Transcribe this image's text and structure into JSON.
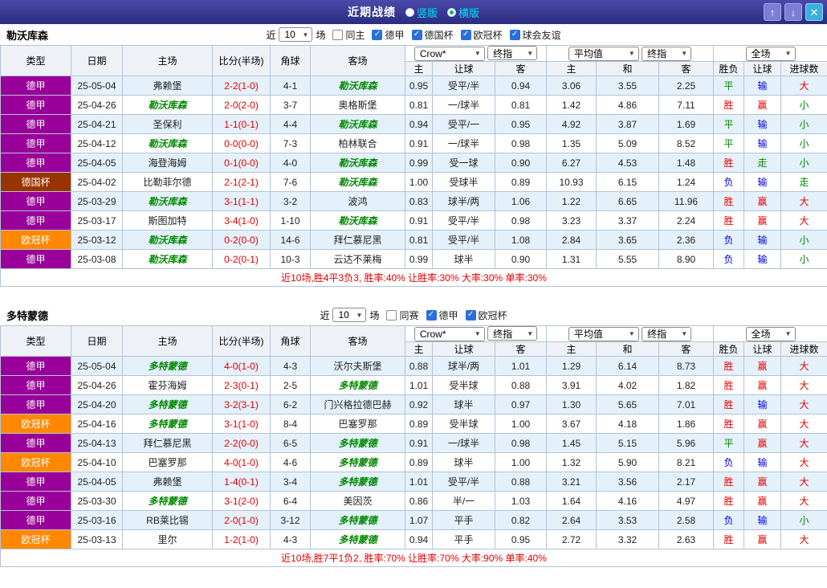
{
  "colors": {
    "topbar": "#2c2c80",
    "row_alt": "#e4f1fb",
    "focus_team": "#008800",
    "score": "#e60000",
    "summary_text": "#e60000",
    "league": {
      "德甲": "#990099",
      "德国杯": "#993300",
      "欧冠杯": "#ff8800"
    },
    "wdl": {
      "胜": "#e60000",
      "平": "#008800",
      "负": "#0000e6"
    },
    "handicap_result": {
      "赢": "#e60000",
      "走": "#008800",
      "输": "#0000e6"
    },
    "goals_result": {
      "大": "#e60000",
      "走": "#008800",
      "小": "#008800"
    }
  },
  "topbar": {
    "title": "近期战绩",
    "radios": [
      {
        "label": "竖版",
        "selected": false
      },
      {
        "label": "横版",
        "selected": true
      }
    ],
    "buttons": {
      "up": "↑",
      "down": "↓",
      "close": "✕"
    }
  },
  "table_header": {
    "type": "类型",
    "date": "日期",
    "home": "主场",
    "score": "比分(半场)",
    "corner": "角球",
    "away": "客场",
    "group1_selects": [
      "Crow*",
      "终指"
    ],
    "group1_cols": [
      "主",
      "让球",
      "客"
    ],
    "group2_selects": [
      "平均值",
      "终指"
    ],
    "group2_cols": [
      "主",
      "和",
      "客"
    ],
    "group3_selects": [
      "全场"
    ],
    "group3_cols": [
      "胜负",
      "让球",
      "进球数"
    ]
  },
  "sections": [
    {
      "team": "勒沃库森",
      "filter": {
        "prefix": "近",
        "count": "10",
        "suffix": "场",
        "unchecked": [
          "同主"
        ],
        "checked": [
          "德甲",
          "德国杯",
          "欧冠杯",
          "球会友谊"
        ]
      },
      "rows": [
        {
          "league": "德甲",
          "date": "25-05-04",
          "home": "弗赖堡",
          "home_focus": false,
          "score": "2-2(1-0)",
          "corner": "4-1",
          "away": "勒沃库森",
          "away_focus": true,
          "o_home": "0.95",
          "handicap": "受平/半",
          "o_away": "0.94",
          "avg_win": "3.06",
          "avg_draw": "3.55",
          "avg_lose": "2.25",
          "wdl": "平",
          "hr": "输",
          "gr": "大"
        },
        {
          "league": "德甲",
          "date": "25-04-26",
          "home": "勒沃库森",
          "home_focus": true,
          "score": "2-0(2-0)",
          "corner": "3-7",
          "away": "奥格斯堡",
          "away_focus": false,
          "o_home": "0.81",
          "handicap": "一/球半",
          "o_away": "0.81",
          "avg_win": "1.42",
          "avg_draw": "4.86",
          "avg_lose": "7.11",
          "wdl": "胜",
          "hr": "赢",
          "gr": "小"
        },
        {
          "league": "德甲",
          "date": "25-04-21",
          "home": "圣保利",
          "home_focus": false,
          "score": "1-1(0-1)",
          "corner": "4-4",
          "away": "勒沃库森",
          "away_focus": true,
          "o_home": "0.94",
          "handicap": "受平/一",
          "o_away": "0.95",
          "avg_win": "4.92",
          "avg_draw": "3.87",
          "avg_lose": "1.69",
          "wdl": "平",
          "hr": "输",
          "gr": "小"
        },
        {
          "league": "德甲",
          "date": "25-04-12",
          "home": "勒沃库森",
          "home_focus": true,
          "score": "0-0(0-0)",
          "corner": "7-3",
          "away": "柏林联合",
          "away_focus": false,
          "o_home": "0.91",
          "handicap": "一/球半",
          "o_away": "0.98",
          "avg_win": "1.35",
          "avg_draw": "5.09",
          "avg_lose": "8.52",
          "wdl": "平",
          "hr": "输",
          "gr": "小"
        },
        {
          "league": "德甲",
          "date": "25-04-05",
          "home": "海登海姆",
          "home_focus": false,
          "score": "0-1(0-0)",
          "corner": "4-0",
          "away": "勒沃库森",
          "away_focus": true,
          "o_home": "0.99",
          "handicap": "受一球",
          "o_away": "0.90",
          "avg_win": "6.27",
          "avg_draw": "4.53",
          "avg_lose": "1.48",
          "wdl": "胜",
          "hr": "走",
          "gr": "小"
        },
        {
          "league": "德国杯",
          "date": "25-04-02",
          "home": "比勒菲尔德",
          "home_focus": false,
          "score": "2-1(2-1)",
          "corner": "7-6",
          "away": "勒沃库森",
          "away_focus": true,
          "o_home": "1.00",
          "handicap": "受球半",
          "o_away": "0.89",
          "avg_win": "10.93",
          "avg_draw": "6.15",
          "avg_lose": "1.24",
          "wdl": "负",
          "hr": "输",
          "gr": "走"
        },
        {
          "league": "德甲",
          "date": "25-03-29",
          "home": "勒沃库森",
          "home_focus": true,
          "score": "3-1(1-1)",
          "corner": "3-2",
          "away": "波鸿",
          "away_focus": false,
          "o_home": "0.83",
          "handicap": "球半/两",
          "o_away": "1.06",
          "avg_win": "1.22",
          "avg_draw": "6.65",
          "avg_lose": "11.96",
          "wdl": "胜",
          "hr": "赢",
          "gr": "大"
        },
        {
          "league": "德甲",
          "date": "25-03-17",
          "home": "斯图加特",
          "home_focus": false,
          "score": "3-4(1-0)",
          "corner": "1-10",
          "away": "勒沃库森",
          "away_focus": true,
          "o_home": "0.91",
          "handicap": "受平/半",
          "o_away": "0.98",
          "avg_win": "3.23",
          "avg_draw": "3.37",
          "avg_lose": "2.24",
          "wdl": "胜",
          "hr": "赢",
          "gr": "大"
        },
        {
          "league": "欧冠杯",
          "date": "25-03-12",
          "home": "勒沃库森",
          "home_focus": true,
          "score": "0-2(0-0)",
          "corner": "14-6",
          "away": "拜仁慕尼黑",
          "away_focus": false,
          "o_home": "0.81",
          "handicap": "受平/半",
          "o_away": "1.08",
          "avg_win": "2.84",
          "avg_draw": "3.65",
          "avg_lose": "2.36",
          "wdl": "负",
          "hr": "输",
          "gr": "小"
        },
        {
          "league": "德甲",
          "date": "25-03-08",
          "home": "勒沃库森",
          "home_focus": true,
          "score": "0-2(0-1)",
          "corner": "10-3",
          "away": "云达不莱梅",
          "away_focus": false,
          "o_home": "0.99",
          "handicap": "球半",
          "o_away": "0.90",
          "avg_win": "1.31",
          "avg_draw": "5.55",
          "avg_lose": "8.90",
          "wdl": "负",
          "hr": "输",
          "gr": "小"
        }
      ],
      "summary": "近10场,胜4平3负3, 胜率:40% 让胜率:30% 大率:30% 单率:30%"
    },
    {
      "team": "多特蒙德",
      "filter": {
        "prefix": "近",
        "count": "10",
        "suffix": "场",
        "unchecked": [
          "同赛"
        ],
        "checked": [
          "德甲",
          "欧冠杯"
        ]
      },
      "rows": [
        {
          "league": "德甲",
          "date": "25-05-04",
          "home": "多特蒙德",
          "home_focus": true,
          "score": "4-0(1-0)",
          "corner": "4-3",
          "away": "沃尔夫斯堡",
          "away_focus": false,
          "o_home": "0.88",
          "handicap": "球半/两",
          "o_away": "1.01",
          "avg_win": "1.29",
          "avg_draw": "6.14",
          "avg_lose": "8.73",
          "wdl": "胜",
          "hr": "赢",
          "gr": "大"
        },
        {
          "league": "德甲",
          "date": "25-04-26",
          "home": "霍芬海姆",
          "home_focus": false,
          "score": "2-3(0-1)",
          "corner": "2-5",
          "away": "多特蒙德",
          "away_focus": true,
          "o_home": "1.01",
          "handicap": "受半球",
          "o_away": "0.88",
          "avg_win": "3.91",
          "avg_draw": "4.02",
          "avg_lose": "1.82",
          "wdl": "胜",
          "hr": "赢",
          "gr": "大"
        },
        {
          "league": "德甲",
          "date": "25-04-20",
          "home": "多特蒙德",
          "home_focus": true,
          "score": "3-2(3-1)",
          "corner": "6-2",
          "away": "门兴格拉德巴赫",
          "away_focus": false,
          "o_home": "0.92",
          "handicap": "球半",
          "o_away": "0.97",
          "avg_win": "1.30",
          "avg_draw": "5.65",
          "avg_lose": "7.01",
          "wdl": "胜",
          "hr": "输",
          "gr": "大"
        },
        {
          "league": "欧冠杯",
          "date": "25-04-16",
          "home": "多特蒙德",
          "home_focus": true,
          "score": "3-1(1-0)",
          "corner": "8-4",
          "away": "巴塞罗那",
          "away_focus": false,
          "o_home": "0.89",
          "handicap": "受半球",
          "o_away": "1.00",
          "avg_win": "3.67",
          "avg_draw": "4.18",
          "avg_lose": "1.86",
          "wdl": "胜",
          "hr": "赢",
          "gr": "大"
        },
        {
          "league": "德甲",
          "date": "25-04-13",
          "home": "拜仁慕尼黑",
          "home_focus": false,
          "score": "2-2(0-0)",
          "corner": "6-5",
          "away": "多特蒙德",
          "away_focus": true,
          "o_home": "0.91",
          "handicap": "一/球半",
          "o_away": "0.98",
          "avg_win": "1.45",
          "avg_draw": "5.15",
          "avg_lose": "5.96",
          "wdl": "平",
          "hr": "赢",
          "gr": "大"
        },
        {
          "league": "欧冠杯",
          "date": "25-04-10",
          "home": "巴塞罗那",
          "home_focus": false,
          "score": "4-0(1-0)",
          "corner": "4-6",
          "away": "多特蒙德",
          "away_focus": true,
          "o_home": "0.89",
          "handicap": "球半",
          "o_away": "1.00",
          "avg_win": "1.32",
          "avg_draw": "5.90",
          "avg_lose": "8.21",
          "wdl": "负",
          "hr": "输",
          "gr": "大"
        },
        {
          "league": "德甲",
          "date": "25-04-05",
          "home": "弗赖堡",
          "home_focus": false,
          "score": "1-4(0-1)",
          "corner": "3-4",
          "away": "多特蒙德",
          "away_focus": true,
          "o_home": "1.01",
          "handicap": "受平/半",
          "o_away": "0.88",
          "avg_win": "3.21",
          "avg_draw": "3.56",
          "avg_lose": "2.17",
          "wdl": "胜",
          "hr": "赢",
          "gr": "大"
        },
        {
          "league": "德甲",
          "date": "25-03-30",
          "home": "多特蒙德",
          "home_focus": true,
          "score": "3-1(2-0)",
          "corner": "6-4",
          "away": "美因茨",
          "away_focus": false,
          "o_home": "0.86",
          "handicap": "半/一",
          "o_away": "1.03",
          "avg_win": "1.64",
          "avg_draw": "4.16",
          "avg_lose": "4.97",
          "wdl": "胜",
          "hr": "赢",
          "gr": "大"
        },
        {
          "league": "德甲",
          "date": "25-03-16",
          "home": "RB莱比锡",
          "home_focus": false,
          "score": "2-0(1-0)",
          "corner": "3-12",
          "away": "多特蒙德",
          "away_focus": true,
          "o_home": "1.07",
          "handicap": "平手",
          "o_away": "0.82",
          "avg_win": "2.64",
          "avg_draw": "3.53",
          "avg_lose": "2.58",
          "wdl": "负",
          "hr": "输",
          "gr": "小"
        },
        {
          "league": "欧冠杯",
          "date": "25-03-13",
          "home": "里尔",
          "home_focus": false,
          "score": "1-2(1-0)",
          "corner": "4-3",
          "away": "多特蒙德",
          "away_focus": true,
          "o_home": "0.94",
          "handicap": "平手",
          "o_away": "0.95",
          "avg_win": "2.72",
          "avg_draw": "3.32",
          "avg_lose": "2.63",
          "wdl": "胜",
          "hr": "赢",
          "gr": "大"
        }
      ],
      "summary": "近10场,胜7平1负2, 胜率:70% 让胜率:70% 大率:90% 单率:40%"
    }
  ]
}
